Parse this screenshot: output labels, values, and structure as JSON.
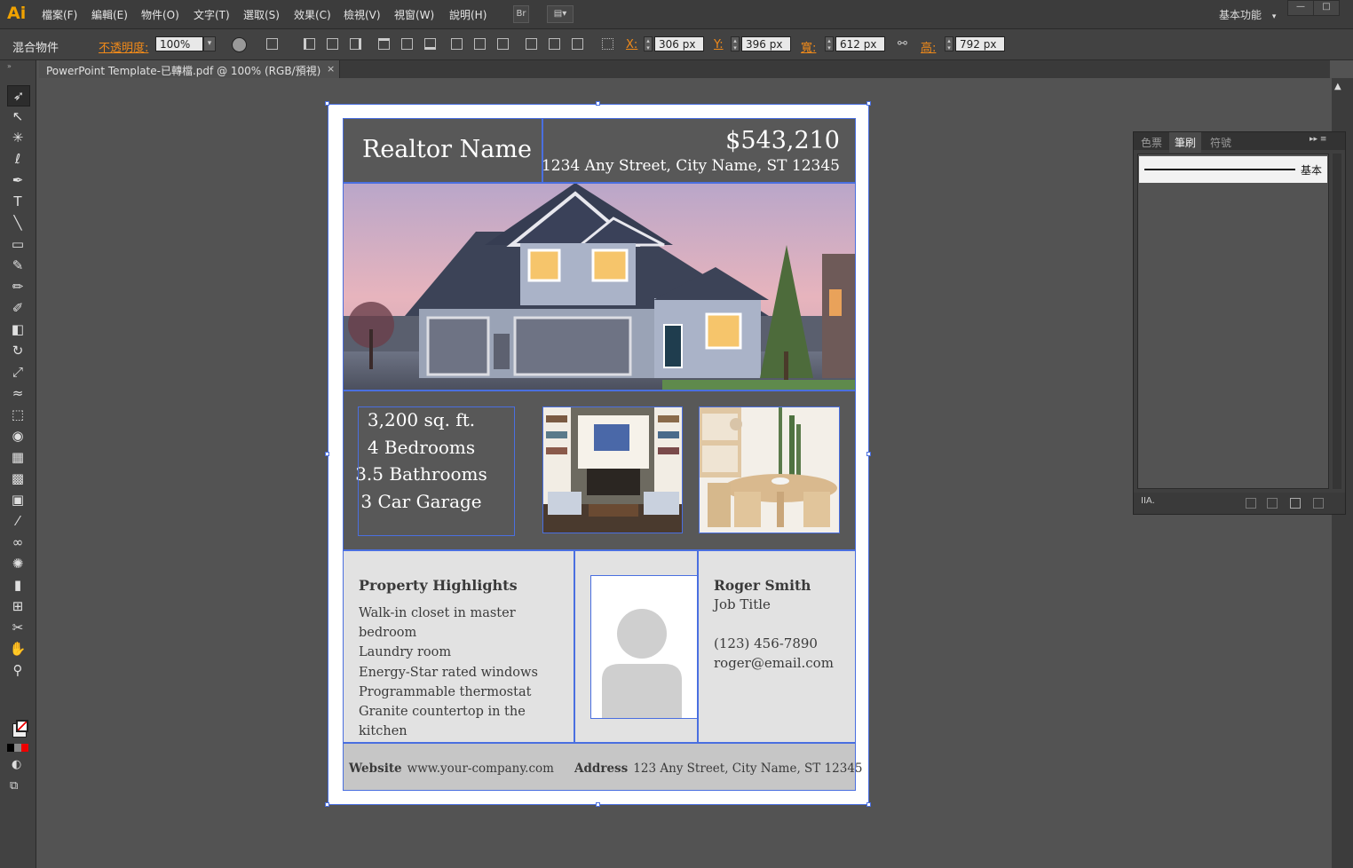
{
  "app": {
    "logo": "Ai",
    "workspace": "基本功能",
    "workspace_caret": "▾"
  },
  "menu": [
    "檔案(F)",
    "編輯(E)",
    "物件(O)",
    "文字(T)",
    "選取(S)",
    "效果(C)",
    "檢視(V)",
    "視窗(W)",
    "說明(H)"
  ],
  "menu_buttons": {
    "bridge": "Br",
    "arrange": "▤▾"
  },
  "window_controls": {
    "minimize": "—",
    "restore": "□"
  },
  "control_bar": {
    "object_label": "混合物件",
    "opacity_label": "不透明度:",
    "opacity_value": "100%",
    "x_label": "X:",
    "x_value": "306 px",
    "y_label": "Y:",
    "y_value": "396 px",
    "w_label": "寬:",
    "w_value": "612 px",
    "h_label": "高:",
    "h_value": "792 px"
  },
  "document_tab": {
    "label": "PowerPoint Template-已轉檔.pdf @ 100% (RGB/預視)",
    "close": "×"
  },
  "tools": [
    "selection-tool",
    "direct-selection-tool",
    "magic-wand-tool",
    "lasso-tool",
    "pen-tool",
    "type-tool",
    "line-tool",
    "rectangle-tool",
    "paintbrush-tool",
    "pencil-tool",
    "blob-brush-tool",
    "eraser-tool",
    "rotate-tool",
    "scale-tool",
    "warp-tool",
    "free-transform-tool",
    "shape-builder-tool",
    "perspective-grid-tool",
    "mesh-tool",
    "gradient-tool",
    "eyedropper-tool",
    "blend-tool",
    "symbol-sprayer-tool",
    "column-graph-tool",
    "artboard-tool",
    "slice-tool",
    "hand-tool",
    "zoom-tool"
  ],
  "tool_glyphs": [
    "➶",
    "↖",
    "✳",
    "ℓ",
    "✒",
    "T",
    "╲",
    "▭",
    "✎",
    "✏",
    "✐",
    "◧",
    "↻",
    "⤢",
    "≈",
    "⬚",
    "◉",
    "▦",
    "▩",
    "▣",
    "⁄",
    "∞",
    "✺",
    "▮",
    "⊞",
    "✂",
    "✋",
    "⚲"
  ],
  "panel": {
    "tabs": [
      "色票",
      "筆刷",
      "符號"
    ],
    "active_tab": "筆刷",
    "menu_glyph": "▸▸  ≡",
    "brush_name": "基本",
    "footer_icon": "IIA."
  },
  "flyer": {
    "realtor_name": "Realtor Name",
    "price": "$543,210",
    "address": "1234 Any Street, City Name, ST 12345",
    "facts": [
      "3,200 sq. ft.",
      "4 Bedrooms",
      "3.5 Bathrooms",
      "3 Car Garage"
    ],
    "highlights_title": "Property Highlights",
    "highlights": [
      "Walk-in closet in master bedroom",
      "Laundry room",
      "Energy-Star rated windows",
      "Programmable thermostat",
      "Granite countertop in the kitchen"
    ],
    "agent_name": "Roger Smith",
    "agent_title": "Job Title",
    "agent_phone": "(123) 456-7890",
    "agent_email": "roger@email.com",
    "footer_website_label": "Website",
    "footer_website": "www.your-company.com",
    "footer_address_label": "Address",
    "footer_address": "123 Any Street, City Name, ST 12345"
  },
  "colors": {
    "app_bg": "#535353",
    "accent_orange": "#f08a1a",
    "selection_blue": "#4a6fe0",
    "header_gray": "#585858",
    "lower_gray": "#e2e2e2",
    "footer_gray": "#c6c6c6"
  }
}
